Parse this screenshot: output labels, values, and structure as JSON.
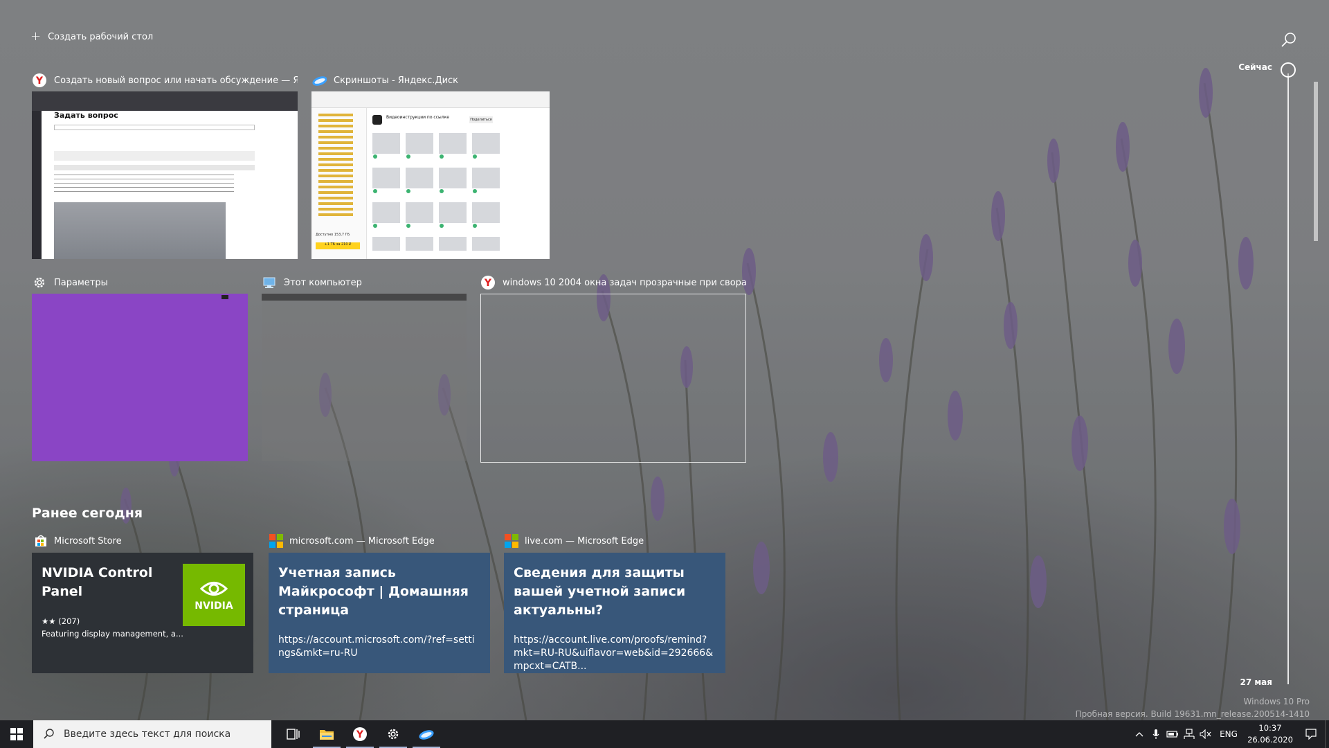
{
  "top": {
    "new_desktop": "Создать рабочий стол"
  },
  "windows": [
    {
      "title": "Создать новый вопрос или начать обсуждение — Янде...",
      "app": "yandex-browser"
    },
    {
      "title": "Скриншоты - Яндекс.Диск",
      "app": "yandex-disk"
    },
    {
      "title": "Параметры",
      "app": "settings"
    },
    {
      "title": "Этот компьютер",
      "app": "this-pc"
    },
    {
      "title": "windows 10 2004 окна задач прозрачные при сворачив...",
      "app": "yandex-browser"
    }
  ],
  "thumb1": {
    "heading": "Задать вопрос"
  },
  "thumb2": {
    "heading": "Видеоинструкции по ссылке",
    "button": "Поделиться",
    "quota": "Доступно 153,7 ГБ",
    "buy": "+1 ТБ за 210 ₽"
  },
  "earlier": {
    "title": "Ранее сегодня",
    "cards": [
      {
        "source": "Microsoft Store",
        "title": "NVIDIA Control Panel",
        "rating": "★★ (207)",
        "desc": "Featuring display management, a...",
        "logo_text": "NVIDIA"
      },
      {
        "source": "microsoft.com — Microsoft Edge",
        "title": "Учетная запись Майкрософт | Домашняя страница",
        "url": "https://account.microsoft.com/?ref=settings&mkt=ru-RU"
      },
      {
        "source": "live.com — Microsoft Edge",
        "title": "Сведения для защиты вашей учетной записи актуальны?",
        "url": "https://account.live.com/proofs/remind?mkt=RU-RU&uiflavor=web&id=292666&mpcxt=CATB..."
      }
    ]
  },
  "timeline": {
    "now": "Сейчас",
    "date": "27 мая"
  },
  "watermark": {
    "line1": "Windows 10 Pro",
    "line2": "Пробная версия. Build 19631.mn_release.200514-1410"
  },
  "taskbar": {
    "search_placeholder": "Введите здесь текст для поиска",
    "lang": "ENG",
    "time": "10:37",
    "date": "26.06.2020"
  },
  "colors": {
    "settings_accent": "#8a45c5",
    "card_dark": "#2d3136",
    "card_blue": "#38577a",
    "nvidia_green": "#76b900",
    "taskbar": "#1f2024"
  }
}
